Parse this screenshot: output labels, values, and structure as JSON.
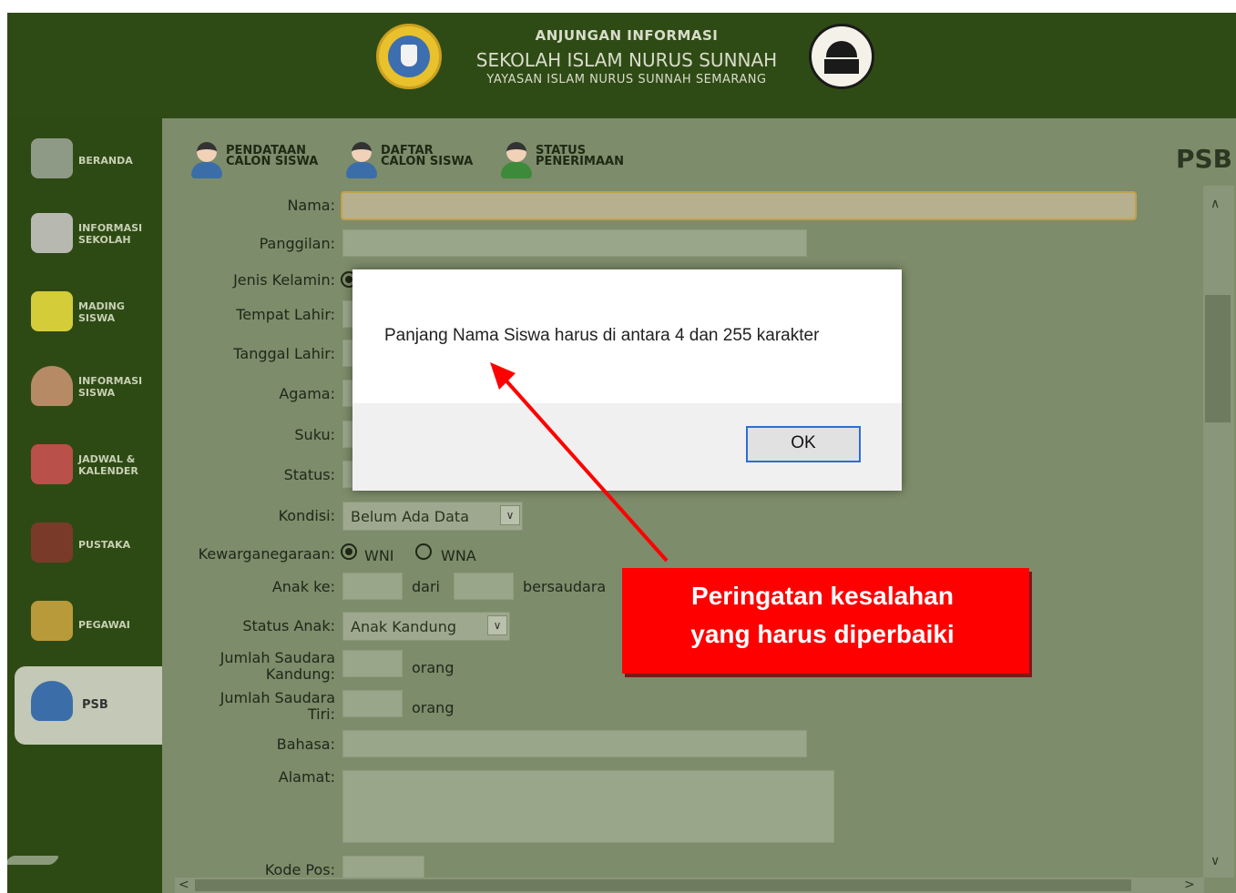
{
  "header": {
    "line1": "ANJUNGAN INFORMASI",
    "line2": "SEKOLAH ISLAM NURUS SUNNAH",
    "line3": "YAYASAN ISLAM NURUS SUNNAH SEMARANG"
  },
  "sidebar": {
    "items": [
      {
        "label": "BERANDA",
        "icon": "home-icon"
      },
      {
        "label": "INFORMASI SEKOLAH",
        "icon": "newspaper-icon"
      },
      {
        "label": "MADING SISWA",
        "icon": "note-icon"
      },
      {
        "label": "INFORMASI SISWA",
        "icon": "student-icon"
      },
      {
        "label": "JADWAL & KALENDER",
        "icon": "calendar-icon"
      },
      {
        "label": "PUSTAKA",
        "icon": "books-icon"
      },
      {
        "label": "PEGAWAI",
        "icon": "org-chart-icon"
      },
      {
        "label": "PSB",
        "icon": "user-icon"
      }
    ]
  },
  "tabs": [
    {
      "line1": "PENDATAAN",
      "line2": "CALON SISWA"
    },
    {
      "line1": "DAFTAR",
      "line2": "CALON SISWA"
    },
    {
      "line1": "STATUS",
      "line2": "PENERIMAAN"
    }
  ],
  "page_title": "PSB",
  "form": {
    "nama": "Nama:",
    "panggilan": "Panggilan:",
    "jenis_kelamin": "Jenis Kelamin:",
    "tempat_lahir": "Tempat Lahir:",
    "tanggal_lahir": "Tanggal Lahir:",
    "agama": "Agama:",
    "suku": "Suku:",
    "status": "Status:",
    "kondisi": "Kondisi:",
    "kondisi_value": "Belum Ada Data",
    "kewarganegaraan": "Kewarganegaraan:",
    "wni": "WNI",
    "wna": "WNA",
    "anak_ke": "Anak ke:",
    "dari": "dari",
    "bersaudara": "bersaudara",
    "status_anak": "Status Anak:",
    "status_anak_value": "Anak Kandung",
    "jumlah_kandung_1": "Jumlah Saudara",
    "jumlah_kandung_2": "Kandung:",
    "jumlah_tiri_1": "Jumlah Saudara",
    "jumlah_tiri_2": "Tiri:",
    "orang": "orang",
    "bahasa": "Bahasa:",
    "alamat": "Alamat:",
    "kode_pos": "Kode Pos:"
  },
  "dialog": {
    "message": "Panjang Nama Siswa harus di antara 4 dan 255 karakter",
    "ok_label": "OK"
  },
  "annotation": {
    "line1": "Peringatan kesalahan",
    "line2": "yang harus diperbaiki"
  },
  "colors": {
    "header_bg": "#2f4b15",
    "content_bg": "#7d8c6a",
    "annotation_red": "#ff0000",
    "dialog_ok_border": "#2c6fd1"
  }
}
